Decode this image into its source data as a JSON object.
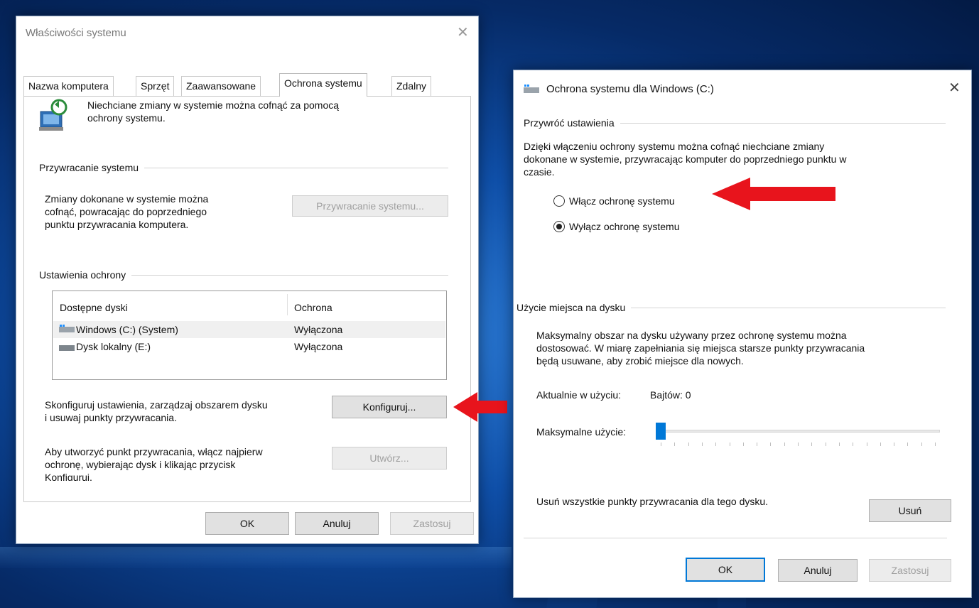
{
  "left_window": {
    "title": "Właściwości systemu",
    "tabs": [
      "Nazwa komputera",
      "Sprzęt",
      "Zaawansowane",
      "Ochrona systemu",
      "Zdalny"
    ],
    "active_tab": "Ochrona systemu",
    "intro_text": [
      "Niechciane zmiany w systemie można cofnąć za pomocą",
      "ochrony systemu."
    ],
    "restore_group": {
      "title": "Przywracanie systemu",
      "text": [
        "Zmiany dokonane w systemie można",
        "cofnąć, powracając do poprzedniego",
        "punktu przywracania komputera."
      ],
      "button": "Przywracanie systemu..."
    },
    "protection_group": {
      "title": "Ustawienia ochrony",
      "columns": [
        "Dostępne dyski",
        "Ochrona"
      ],
      "rows": [
        {
          "drive": "Windows (C:) (System)",
          "status": "Wyłączona"
        },
        {
          "drive": "Dysk lokalny (E:)",
          "status": "Wyłączona"
        }
      ],
      "configure_text": [
        "Skonfiguruj ustawienia, zarządzaj obszarem dysku",
        "i usuwaj punkty przywracania."
      ],
      "configure_button": "Konfiguruj...",
      "create_text": [
        "Aby utworzyć punkt przywracania, włącz najpierw",
        "ochronę, wybierając dysk i klikając przycisk",
        "Konfiguruj."
      ],
      "create_button": "Utwórz..."
    },
    "buttons": {
      "ok": "OK",
      "cancel": "Anuluj",
      "apply": "Zastosuj"
    }
  },
  "right_window": {
    "title": "Ochrona systemu dla Windows (C:)",
    "restore_group": {
      "title": "Przywróć ustawienia",
      "text": [
        "Dzięki włączeniu ochrony systemu można cofnąć niechciane zmiany",
        "dokonane w systemie, przywracając komputer do poprzedniego punktu w",
        "czasie."
      ],
      "options": [
        {
          "label": "Włącz ochronę systemu",
          "checked": false
        },
        {
          "label": "Wyłącz ochronę systemu",
          "checked": true
        }
      ]
    },
    "disk_group": {
      "title": "Użycie miejsca na dysku",
      "text": [
        "Maksymalny obszar na dysku używany przez ochronę systemu można",
        "dostosować. W miarę zapełniania się miejsca starsze punkty przywracania",
        "będą usuwane, aby zrobić miejsce dla nowych."
      ],
      "current_usage_label": "Aktualnie w użyciu:",
      "current_usage_value": "Bajtów: 0",
      "max_usage_label": "Maksymalne użycie:",
      "max_usage_fraction": 0.0,
      "delete_text": "Usuń wszystkie punkty przywracania dla tego dysku.",
      "delete_button": "Usuń"
    },
    "buttons": {
      "ok": "OK",
      "cancel": "Anuluj",
      "apply": "Zastosuj"
    }
  },
  "colors": {
    "accent": "#0078d7",
    "arrow": "#e8141c",
    "disabled_text": "#a0a0a0"
  },
  "icons": [
    "system-protection-icon",
    "drive-icon",
    "close-icon",
    "red-arrow-icon"
  ]
}
